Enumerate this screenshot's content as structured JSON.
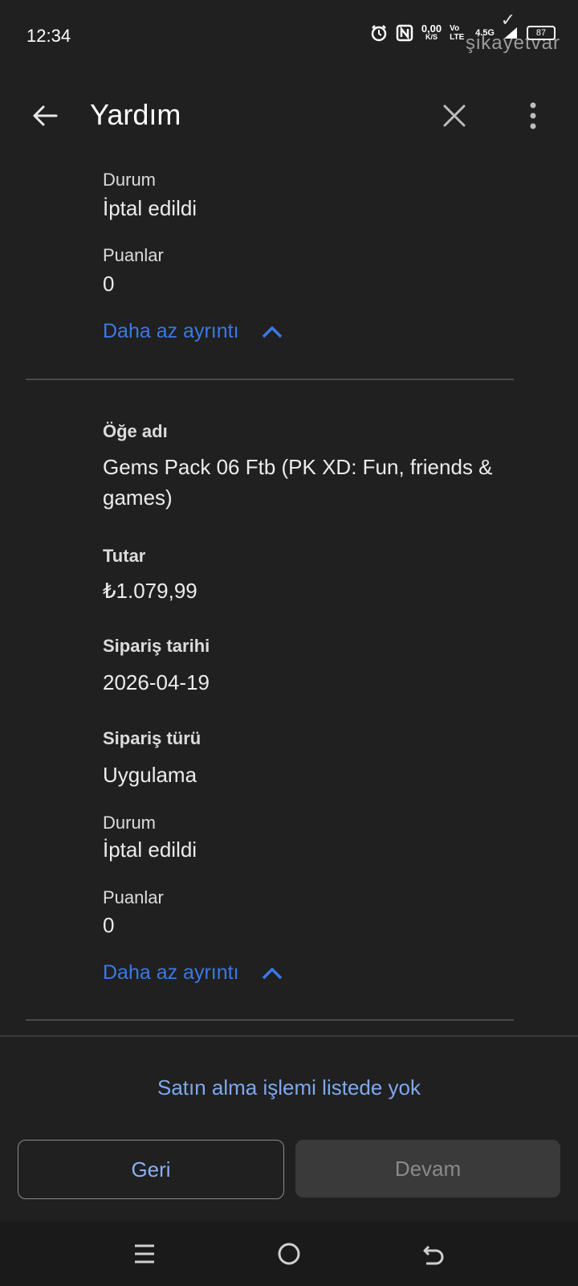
{
  "status_bar": {
    "time": "12:34",
    "net_speed_value": "0,00",
    "net_speed_unit": "K/S",
    "volte": "Vo LTE",
    "network": "4.5G",
    "battery": "87",
    "watermark": "şikayetvar"
  },
  "app_bar": {
    "title": "Yardım",
    "icons": [
      "arrow-back-icon",
      "close-icon",
      "more-vert-icon"
    ]
  },
  "prev_item": {
    "status_label": "Durum",
    "status_value": "İptal edildi",
    "points_label": "Puanlar",
    "points_value": "0",
    "less_details": "Daha az ayrıntı"
  },
  "item": {
    "name_label": "Öğe adı",
    "name_value": "Gems Pack 06 Ftb (PK XD: Fun, friends & games)",
    "amount_label": "Tutar",
    "amount_value": "₺1.079,99",
    "order_date_label": "Sipariş tarihi",
    "order_date_value": "2026-04-19",
    "order_type_label": "Sipariş türü",
    "order_type_value": "Uygulama",
    "status_label": "Durum",
    "status_value": "İptal edildi",
    "points_label": "Puanlar",
    "points_value": "0",
    "less_details": "Daha az ayrıntı"
  },
  "footer": {
    "not_listed": "Satın alma işlemi listede yok",
    "back_label": "Geri",
    "continue_label": "Devam"
  },
  "nav_bar": {
    "icons": [
      "menu-icon",
      "home-circle-icon",
      "back-return-icon"
    ]
  },
  "colors": {
    "background": "#202020",
    "link_blue": "#3b78e7",
    "light_blue": "#8ab0f0",
    "disabled_button": "#3a3a3a"
  }
}
